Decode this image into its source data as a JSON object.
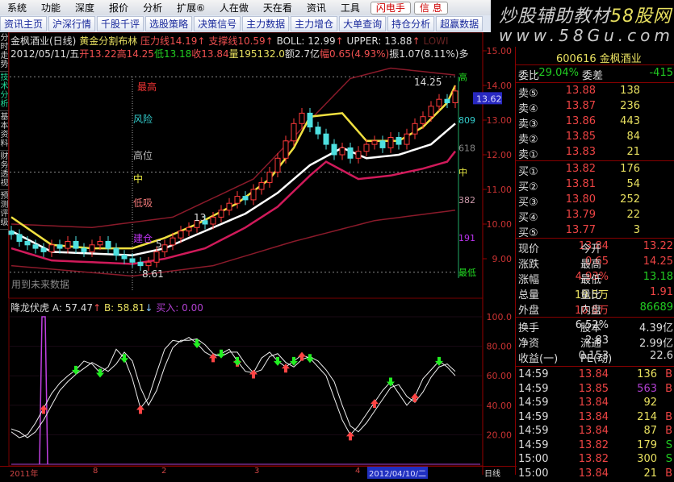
{
  "menu": [
    "系统",
    "功能",
    "深度",
    "报价",
    "分析",
    "扩展⑥",
    "人在做",
    "天在看",
    "资讯",
    "工具"
  ],
  "menu_buttons": [
    "闪电手",
    "信 息"
  ],
  "toolbar": [
    "资讯主页",
    "沪深行情",
    "千股千评",
    "选股策略",
    "决策信号",
    "主力数据",
    "主力增仓",
    "大单查询",
    "持仓分析",
    "超赢数据"
  ],
  "banner": {
    "title": "炒股辅助教材",
    "brand": "58股网",
    "url": "www.58Gu.com"
  },
  "left_tabs": [
    "分时走势",
    "技术分析",
    "基本资料",
    "财务透视",
    "预测评级"
  ],
  "header": {
    "line1": {
      "name": "金枫酒业(日线)",
      "indicator": "黄金分割布林",
      "pressure_label": "压力线",
      "pressure": "14.19",
      "support_label": "支撑线",
      "support": "10.59",
      "boll": "BOLL: 12.99",
      "upper": "UPPER: 13.88",
      "lower": "LOWI"
    },
    "line2": {
      "date": "2012/05/11/五",
      "open": "开13.22",
      "high": "高14.25",
      "low": "低13.18",
      "close": "收13.84",
      "vol": "量195132.0",
      "amount": "额2.7亿",
      "chg": "幅0.65(4.93%)",
      "amp": "振1.07(8.11%)",
      "more": "多"
    }
  },
  "main_labels": {
    "top": "最高",
    "risk": "风险",
    "high": "高位",
    "mid": "中",
    "low_buy": "低吸",
    "bottom": "建仓",
    "future": "用到未来数据",
    "hi_val": "14.25",
    "lo_val": "8.61",
    "m5": "5",
    "m13": "13"
  },
  "fib_labels": [
    "高",
    "809",
    "618",
    "中",
    "382",
    "191",
    "最低"
  ],
  "price_axis": [
    "15.00",
    "14.00",
    "13.00",
    "12.00",
    "11.00",
    "10.00",
    "9.00"
  ],
  "current_price_tag": "13.62",
  "indicator_header": {
    "name": "降龙伏虎",
    "a": "A: 57.47",
    "b": "B: 58.81",
    "buy": "买入: 0.00"
  },
  "indicator_axis": [
    "100.0",
    "80.00",
    "60.00",
    "40.00",
    "20.00"
  ],
  "date_axis": {
    "labels": [
      "2011年",
      "8",
      "2",
      "3",
      "4"
    ],
    "cursor": "2012/04/10/二",
    "period": "日线"
  },
  "chart_data": [
    {
      "type": "candlestick",
      "title": "金枫酒业(日线) 黄金分割布林",
      "ylim": [
        8.5,
        15.0
      ],
      "close": [
        9.7,
        9.5,
        9.4,
        9.3,
        9.2,
        9.4,
        9.3,
        9.5,
        9.3,
        9.2,
        9.4,
        9.5,
        9.3,
        9.1,
        9.0,
        8.9,
        8.8,
        8.9,
        9.2,
        9.4,
        9.6,
        9.8,
        9.9,
        10.1,
        10.0,
        10.2,
        10.4,
        10.6,
        10.8,
        10.7,
        11.0,
        11.2,
        11.5,
        11.9,
        12.4,
        12.9,
        13.2,
        12.8,
        12.6,
        12.3,
        12.0,
        12.2,
        11.9,
        12.1,
        12.3,
        12.4,
        12.2,
        12.5,
        12.3,
        12.6,
        12.9,
        13.1,
        13.4,
        13.6,
        13.5,
        13.84
      ],
      "series": [
        {
          "name": "upper",
          "color": "#f0e040",
          "points": [
            [
              0,
              10.2
            ],
            [
              5,
              9.4
            ],
            [
              10,
              9.3
            ],
            [
              15,
              9.3
            ],
            [
              19,
              9.6
            ],
            [
              23,
              10.0
            ],
            [
              28,
              10.6
            ],
            [
              32,
              11.3
            ],
            [
              35,
              12.2
            ],
            [
              37,
              13.1
            ],
            [
              41,
              13.2
            ],
            [
              44,
              12.4
            ],
            [
              48,
              12.4
            ],
            [
              51,
              12.8
            ],
            [
              54,
              13.5
            ],
            [
              55,
              14.0
            ]
          ]
        },
        {
          "name": "mid",
          "color": "#ffffff",
          "points": [
            [
              0,
              9.8
            ],
            [
              5,
              9.2
            ],
            [
              15,
              9.1
            ],
            [
              19,
              9.3
            ],
            [
              24,
              9.8
            ],
            [
              29,
              10.3
            ],
            [
              33,
              10.9
            ],
            [
              37,
              11.7
            ],
            [
              41,
              12.2
            ],
            [
              44,
              11.9
            ],
            [
              48,
              12.0
            ],
            [
              52,
              12.3
            ],
            [
              55,
              12.9
            ]
          ]
        },
        {
          "name": "lower",
          "color": "#d01a5a",
          "points": [
            [
              0,
              9.3
            ],
            [
              5,
              8.95
            ],
            [
              15,
              8.85
            ],
            [
              19,
              9.0
            ],
            [
              24,
              9.3
            ],
            [
              29,
              9.9
            ],
            [
              33,
              10.5
            ],
            [
              37,
              11.4
            ],
            [
              39,
              11.8
            ],
            [
              43,
              11.3
            ],
            [
              47,
              11.4
            ],
            [
              51,
              11.6
            ],
            [
              54,
              11.8
            ],
            [
              55,
              12.1
            ]
          ]
        },
        {
          "name": "outer-top",
          "color": "#8a1a2a",
          "points": [
            [
              0,
              10.0
            ],
            [
              10,
              9.9
            ],
            [
              20,
              10.2
            ],
            [
              30,
              11.3
            ],
            [
              37,
              13.0
            ],
            [
              42,
              14.2
            ],
            [
              47,
              14.5
            ],
            [
              55,
              14.3
            ]
          ]
        },
        {
          "name": "outer-bottom",
          "color": "#8a1a2a",
          "points": [
            [
              0,
              8.8
            ],
            [
              15,
              8.5
            ],
            [
              25,
              8.8
            ],
            [
              35,
              9.5
            ],
            [
              45,
              10.1
            ],
            [
              55,
              10.4
            ]
          ]
        }
      ]
    },
    {
      "type": "line",
      "title": "降龙伏虎",
      "ylim": [
        0,
        100
      ],
      "series": [
        {
          "name": "A",
          "values": [
            22,
            18,
            20,
            28,
            38,
            48,
            55,
            60,
            64,
            70,
            68,
            62,
            66,
            78,
            72,
            58,
            38,
            45,
            62,
            78,
            84,
            83,
            86,
            82,
            76,
            73,
            75,
            78,
            70,
            63,
            62,
            72,
            76,
            70,
            66,
            70,
            74,
            72,
            66,
            60,
            45,
            30,
            20,
            26,
            34,
            42,
            50,
            56,
            48,
            40,
            46,
            58,
            64,
            70,
            66,
            60
          ]
        },
        {
          "name": "B",
          "values": [
            24,
            22,
            18,
            22,
            30,
            40,
            50,
            56,
            61,
            65,
            69,
            66,
            63,
            68,
            76,
            70,
            52,
            40,
            50,
            66,
            79,
            84,
            84,
            85,
            81,
            75,
            73,
            76,
            76,
            68,
            62,
            64,
            73,
            75,
            69,
            66,
            71,
            73,
            70,
            64,
            56,
            40,
            26,
            22,
            28,
            36,
            44,
            52,
            54,
            46,
            42,
            49,
            59,
            66,
            68,
            63
          ]
        },
        {
          "name": "buy-signal",
          "values": [
            0,
            0,
            0,
            0,
            100,
            0
          ]
        }
      ],
      "markers": [
        {
          "i": 4,
          "type": "buy"
        },
        {
          "i": 8,
          "type": "sell"
        },
        {
          "i": 11,
          "type": "sell"
        },
        {
          "i": 14,
          "type": "sell"
        },
        {
          "i": 16,
          "type": "buy"
        },
        {
          "i": 23,
          "type": "sell"
        },
        {
          "i": 25,
          "type": "buy"
        },
        {
          "i": 26,
          "type": "sell"
        },
        {
          "i": 28,
          "type": "buy"
        },
        {
          "i": 28,
          "type": "sell"
        },
        {
          "i": 30,
          "type": "buy"
        },
        {
          "i": 33,
          "type": "sell"
        },
        {
          "i": 34,
          "type": "buy"
        },
        {
          "i": 35,
          "type": "sell"
        },
        {
          "i": 36,
          "type": "buy"
        },
        {
          "i": 37,
          "type": "sell"
        },
        {
          "i": 42,
          "type": "buy"
        },
        {
          "i": 45,
          "type": "buy"
        },
        {
          "i": 47,
          "type": "sell"
        },
        {
          "i": 50,
          "type": "buy"
        },
        {
          "i": 53,
          "type": "sell"
        }
      ]
    }
  ],
  "quote": {
    "title": "600616 金枫酒业",
    "weibi_label": "委比",
    "weibi": "-29.04%",
    "weicha_label": "委差",
    "weicha": "-415",
    "asks": [
      {
        "l": "卖⑤",
        "p": "13.88",
        "v": "138"
      },
      {
        "l": "卖④",
        "p": "13.87",
        "v": "236"
      },
      {
        "l": "卖③",
        "p": "13.86",
        "v": "443"
      },
      {
        "l": "卖②",
        "p": "13.85",
        "v": "84"
      },
      {
        "l": "卖①",
        "p": "13.83",
        "v": "21"
      }
    ],
    "bids": [
      {
        "l": "买①",
        "p": "13.82",
        "v": "176"
      },
      {
        "l": "买②",
        "p": "13.81",
        "v": "54"
      },
      {
        "l": "买③",
        "p": "13.80",
        "v": "252"
      },
      {
        "l": "买④",
        "p": "13.79",
        "v": "22"
      },
      {
        "l": "买⑤",
        "p": "13.77",
        "v": "3"
      }
    ],
    "stats": [
      [
        "现价",
        "13.84",
        "今开",
        "13.22"
      ],
      [
        "涨跌",
        "0.65",
        "最高",
        "14.25"
      ],
      [
        "涨幅",
        "4.93%",
        "最低",
        "13.18"
      ],
      [
        "总量",
        "19.5万",
        "量比",
        "1.91"
      ],
      [
        "外盘",
        "10.8万",
        "内盘",
        "86689"
      ]
    ],
    "fund": [
      [
        "换手",
        "6.52%",
        "股本",
        "4.39亿"
      ],
      [
        "净资",
        "2.83",
        "流通",
        "2.99亿"
      ],
      [
        "收益(一)",
        "0.153",
        "PE(动)",
        "22.6"
      ]
    ],
    "ticks": [
      [
        "14:59",
        "13.84",
        "136",
        "B"
      ],
      [
        "14:59",
        "13.85",
        "563",
        "B"
      ],
      [
        "14:59",
        "13.84",
        "92",
        ""
      ],
      [
        "14:59",
        "13.84",
        "214",
        "B"
      ],
      [
        "14:59",
        "13.84",
        "87",
        "B"
      ],
      [
        "14:59",
        "13.82",
        "179",
        "S"
      ],
      [
        "15:00",
        "13.82",
        "300",
        "S"
      ],
      [
        "15:00",
        "13.84",
        "21",
        "B"
      ]
    ]
  }
}
